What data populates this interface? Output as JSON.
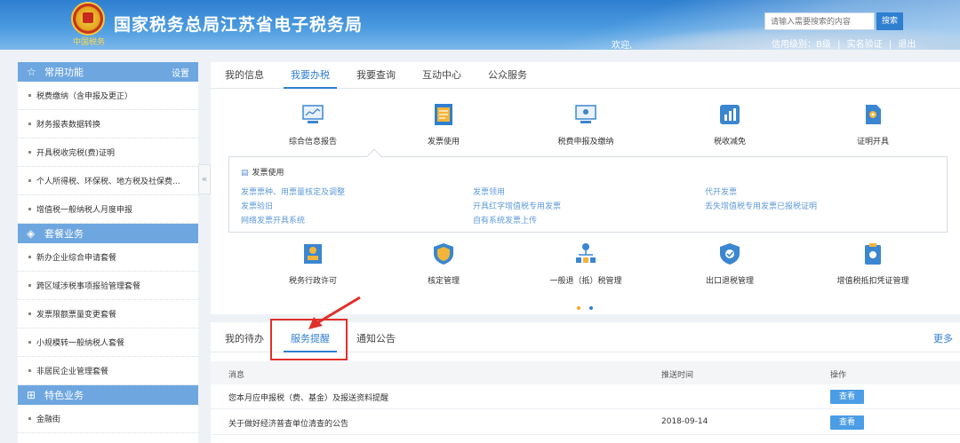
{
  "header": {
    "title": "国家税务总局江苏省电子税务局",
    "emblem_text": "中国税务",
    "search_placeholder": "请输入需要搜索的内容",
    "search_button": "搜索",
    "welcome": "欢迎,",
    "credit_level": "信用级别：B级",
    "sep1": "|",
    "realname": "实名验证",
    "sep2": "|",
    "logout": "退出"
  },
  "sidebar": {
    "sections": [
      {
        "title": "常用功能",
        "icon": "star-icon",
        "setting": "设置"
      },
      {
        "title": "套餐业务",
        "icon": "layers-icon"
      },
      {
        "title": "特色业务",
        "icon": "grid-icon"
      }
    ],
    "common_items": [
      "税费缴纳（含申报及更正）",
      "财务报表数据转换",
      "开具税收完税(费)证明",
      "个人所得税、环保税、地方税及社保费...",
      "增值税一般纳税人月度申报"
    ],
    "package_items": [
      "新办企业综合申请套餐",
      "跨区域涉税事项报验管理套餐",
      "发票限额票量变更套餐",
      "小规模转一般纳税人套餐",
      "非居民企业管理套餐"
    ],
    "special_items": [
      "金融街"
    ],
    "collapse": "«"
  },
  "top_panel": {
    "tabs": [
      "我的信息",
      "我要办税",
      "我要查询",
      "互动中心",
      "公众服务"
    ],
    "active_tab": "我要办税",
    "row1": [
      {
        "label": "综合信息报告",
        "icon": "monitor-chart-icon"
      },
      {
        "label": "发票使用",
        "icon": "document-icon"
      },
      {
        "label": "税费申报及缴纳",
        "icon": "monitor-icon"
      },
      {
        "label": "税收减免",
        "icon": "bar-chart-icon"
      },
      {
        "label": "证明开具",
        "icon": "certificate-icon"
      }
    ],
    "sub_panel": {
      "title": "发票使用",
      "links": [
        "发票票种、用票量核定及调整",
        "发票领用",
        "代开发票",
        "发票验旧",
        "开具红字增值税专用发票",
        "丢失增值税专用发票已报税证明",
        "网络发票开具系统",
        "自有系统发票上传"
      ]
    },
    "row2": [
      {
        "label": "税务行政许可",
        "icon": "person-card-icon"
      },
      {
        "label": "核定管理",
        "icon": "shield-icon"
      },
      {
        "label": "一般退（抵）税管理",
        "icon": "org-chart-icon"
      },
      {
        "label": "出口退税管理",
        "icon": "shield-check-icon"
      },
      {
        "label": "增值税抵扣凭证管理",
        "icon": "clipboard-icon"
      }
    ],
    "carousel_colors": [
      "#f5a623",
      "#2f7fd0"
    ]
  },
  "bottom_panel": {
    "tabs": [
      "我的待办",
      "服务提醒",
      "通知公告"
    ],
    "active_tab": "服务提醒",
    "more": "更多",
    "columns": [
      "消息",
      "推送时间",
      "操作"
    ],
    "rows": [
      {
        "message": "您本月应申报税（费、基金）及报送资料提醒",
        "time": "",
        "action": "查看"
      },
      {
        "message": "关于做好经济普查单位清查的公告",
        "time": "2018-09-14",
        "action": "查看"
      }
    ]
  },
  "colors": {
    "accent": "#2f7fd0",
    "sidebar_header": "#6ea7e0",
    "link": "#5f9ad6",
    "highlight": "#e0302a"
  }
}
